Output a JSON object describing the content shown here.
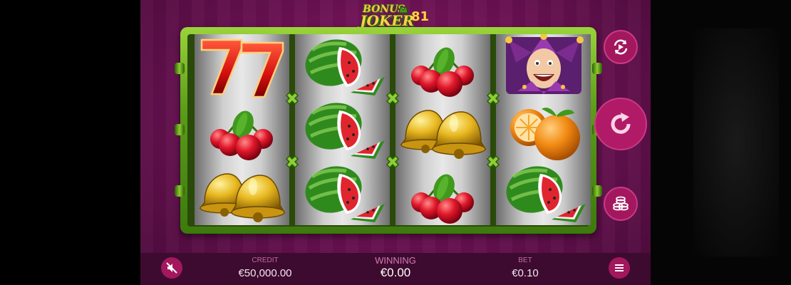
{
  "game": {
    "logo_line1": "BONUS",
    "logo_line2": "JOKER",
    "logo_number": "81"
  },
  "reels": [
    [
      "sevens-symbol",
      "cherries-symbol",
      "bells-symbol"
    ],
    [
      "watermelon-symbol",
      "watermelon-symbol",
      "watermelon-symbol"
    ],
    [
      "cherries-symbol",
      "bells-symbol",
      "cherries-symbol"
    ],
    [
      "joker-symbol",
      "orange-symbol",
      "watermelon-symbol"
    ]
  ],
  "side_buttons": [
    "autoplay-icon",
    "spin-icon",
    "coins-icon"
  ],
  "bottom_bar": {
    "credit_label": "CREDIT",
    "credit_value": "€50,000.00",
    "winning_label": "WINNING",
    "winning_value": "€0.00",
    "bet_label": "BET",
    "bet_value": "€0.10"
  },
  "icons": {
    "sound": "sound-muted-icon",
    "menu": "menu-icon"
  },
  "colors": {
    "background": "#66104f",
    "frame_green": "#5a9d18",
    "button_magenta": "#a3175f"
  }
}
